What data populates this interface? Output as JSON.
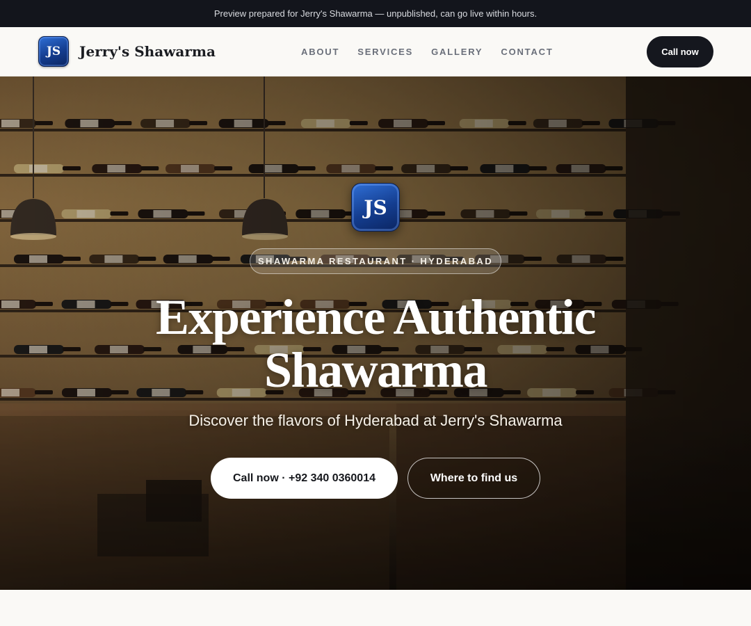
{
  "preview_banner": "Preview prepared for Jerry's Shawarma — unpublished, can go live within hours.",
  "header": {
    "logo_initials": "JS",
    "brand_name": "Jerry's Shawarma",
    "nav": [
      "ABOUT",
      "SERVICES",
      "GALLERY",
      "CONTACT"
    ],
    "cta_label": "Call now"
  },
  "hero": {
    "logo_initials": "JS",
    "badge": "SHAWARMA RESTAURANT · HYDERABAD",
    "title": "Experience Authentic Shawarma",
    "subtitle": "Discover the flavors of Hyderabad at Jerry's Shawarma",
    "primary_button": "Call now · +92 340 0360014",
    "secondary_button": "Where to find us",
    "background_image": "restaurant interior with wall-mounted wine bottle racks and pendant lamps"
  },
  "colors": {
    "topbar_bg": "#13151c",
    "page_bg": "#faf9f6",
    "dark_button": "#15171e",
    "logo_blue": "#143d8f"
  }
}
